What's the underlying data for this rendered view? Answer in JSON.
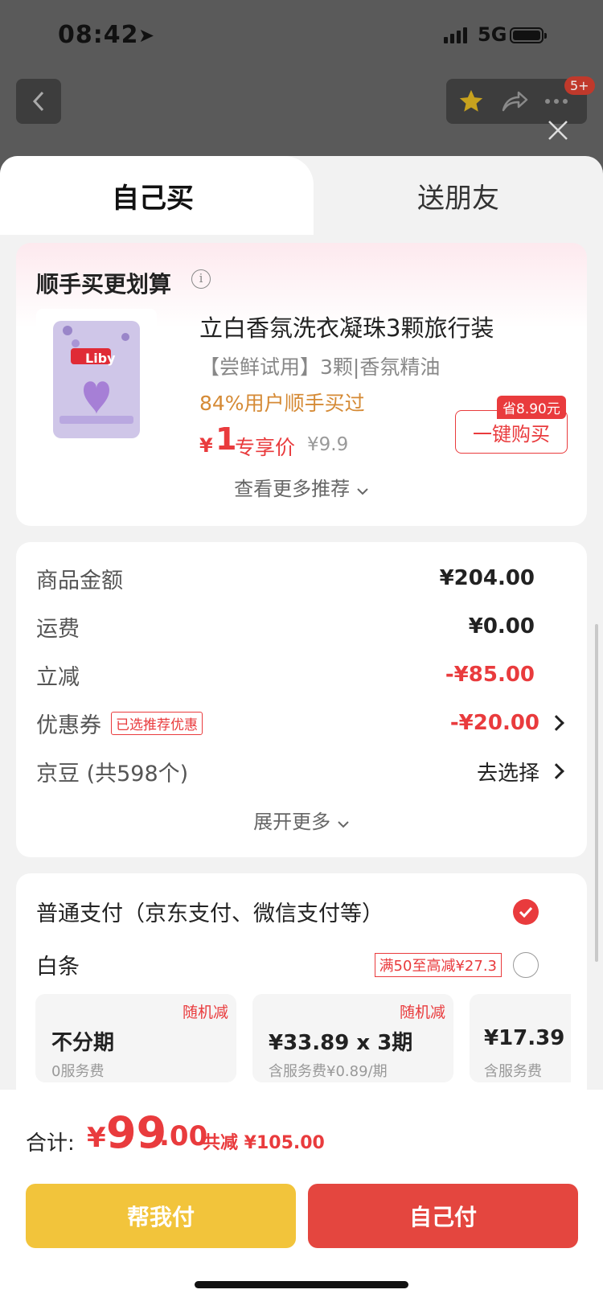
{
  "status_bar": {
    "time": "08:42",
    "network": "5G"
  },
  "header": {
    "badge": "5+"
  },
  "tabs": [
    {
      "label": "自己买",
      "active": true
    },
    {
      "label": "送朋友",
      "active": false
    }
  ],
  "recommend": {
    "title": "顺手买更划算",
    "product": {
      "brand": "Liby",
      "name": "立白香氛洗衣凝珠3颗旅行装",
      "subtitle": "【尝鲜试用】3颗|香氛精油",
      "buyers": "84%用户顺手买过",
      "currency": "¥",
      "price": "1",
      "price_label": "专享价",
      "original_price": "¥9.9",
      "save_tag": "省8.90元",
      "buy_label": "一键购买"
    },
    "more_label": "查看更多推荐"
  },
  "summary": {
    "rows": [
      {
        "label": "商品金额",
        "value": "¥204.00"
      },
      {
        "label": "运费",
        "value": "¥0.00"
      },
      {
        "label": "立减",
        "value": "-¥85.00"
      },
      {
        "label": "优惠券",
        "tag": "已选推荐优惠",
        "value": "-¥20.00"
      },
      {
        "label": "京豆 (共598个)",
        "value": "去选择"
      }
    ],
    "expand_label": "展开更多"
  },
  "payment": {
    "normal": "普通支付（京东支付、微信支付等）",
    "baitiao": "白条",
    "baitiao_promo": "满50至高减¥27.3",
    "installments": [
      {
        "tag": "随机减",
        "main": "不分期",
        "sub": "0服务费"
      },
      {
        "tag": "随机减",
        "main": "¥33.89 x 3期",
        "sub": "含服务费¥0.89/期"
      },
      {
        "tag": "",
        "main": "¥17.39",
        "sub": "含服务费"
      }
    ]
  },
  "footer": {
    "total_label": "合计:",
    "currency": "¥",
    "total_int": "99",
    "total_dec": ".00",
    "total_save": "共减 ¥105.00",
    "help_pay": "帮我付",
    "self_pay": "自己付"
  },
  "colors": {
    "accent": "#e93b3d",
    "gold": "#f2c43b",
    "orange": "#d58a35"
  }
}
